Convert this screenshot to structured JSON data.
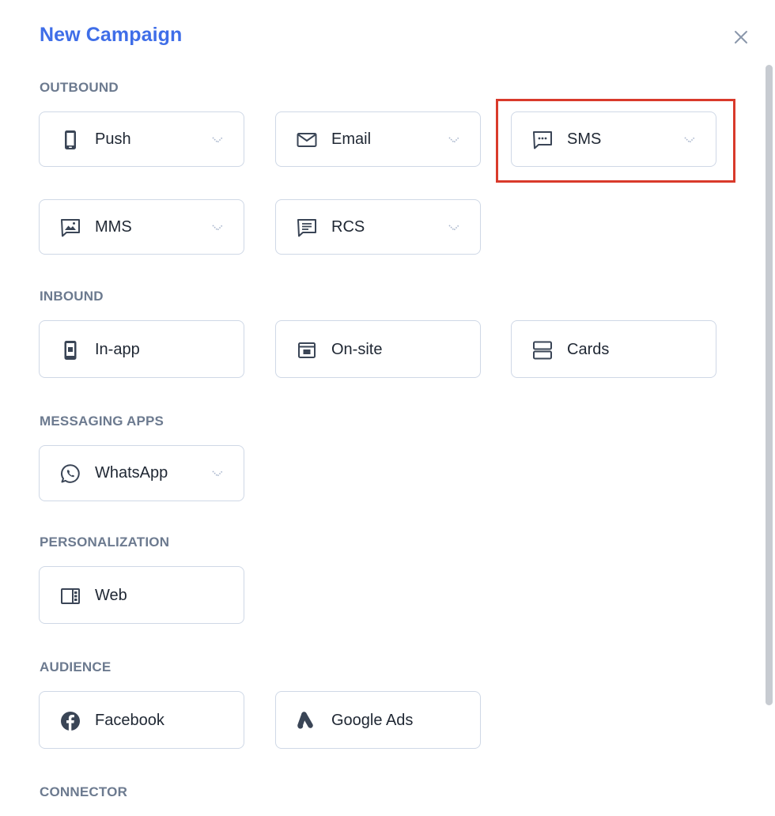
{
  "modal": {
    "title": "New Campaign",
    "close_icon": "close-icon"
  },
  "sections": {
    "outbound": {
      "label": "OUTBOUND",
      "items": [
        {
          "label": "Push",
          "icon": "mobile-phone-icon",
          "has_dropdown": true
        },
        {
          "label": "Email",
          "icon": "envelope-icon",
          "has_dropdown": true
        },
        {
          "label": "SMS",
          "icon": "chat-bubble-dots-icon",
          "has_dropdown": true
        },
        {
          "label": "MMS",
          "icon": "image-message-icon",
          "has_dropdown": true
        },
        {
          "label": "RCS",
          "icon": "message-lines-icon",
          "has_dropdown": true
        }
      ]
    },
    "inbound": {
      "label": "INBOUND",
      "items": [
        {
          "label": "In-app",
          "icon": "in-app-icon"
        },
        {
          "label": "On-site",
          "icon": "browser-window-icon"
        },
        {
          "label": "Cards",
          "icon": "stacked-cards-icon"
        }
      ]
    },
    "messaging_apps": {
      "label": "MESSAGING APPS",
      "items": [
        {
          "label": "WhatsApp",
          "icon": "whatsapp-icon",
          "has_dropdown": true
        }
      ]
    },
    "personalization": {
      "label": "PERSONALIZATION",
      "items": [
        {
          "label": "Web",
          "icon": "web-layout-icon"
        }
      ]
    },
    "audience": {
      "label": "AUDIENCE",
      "items": [
        {
          "label": "Facebook",
          "icon": "facebook-icon"
        },
        {
          "label": "Google Ads",
          "icon": "google-ads-icon"
        }
      ]
    },
    "connector": {
      "label": "CONNECTOR"
    }
  },
  "colors": {
    "title": "#3f6ee8",
    "section_label": "#6c7a8f",
    "card_border": "#cfd8e6",
    "highlight": "#d93a2b",
    "icon": "#3a4556"
  }
}
